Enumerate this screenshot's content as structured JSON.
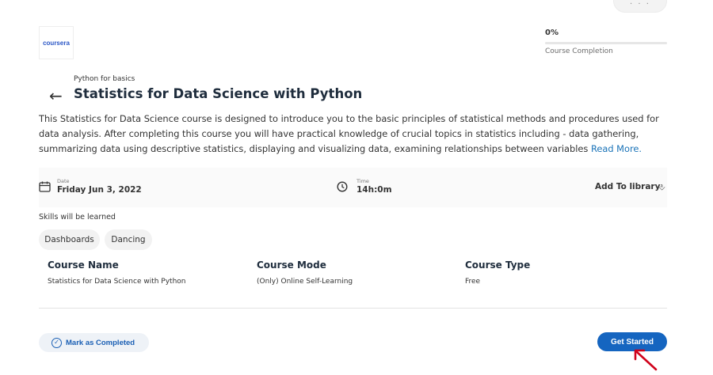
{
  "header": {
    "logo_text": "coursera",
    "top_pill_dots": "· · ·",
    "progress": {
      "percent_label": "0%",
      "fraction": 0,
      "label": "Course Completion"
    },
    "breadcrumb": "Python for basics",
    "title": "Statistics for Data Science with Python"
  },
  "description": {
    "text": "This Statistics for Data Science course is designed to introduce you to the basic principles of statistical methods and procedures used for data analysis. After completing this course you will have practical knowledge of crucial topics in statistics including - data gathering, summarizing data using descriptive statistics, displaying and visualizing data, examining relationships between variables ",
    "read_more": "Read More."
  },
  "info": {
    "date_label": "Date",
    "date_value": "Friday Jun 3, 2022",
    "time_label": "Time",
    "time_value": "14h:0m",
    "add_library": "Add To library"
  },
  "skills": {
    "title": "Skills will be learned",
    "items": [
      "Dashboards",
      "Dancing"
    ]
  },
  "details": {
    "course_name_head": "Course Name",
    "course_name": "Statistics for Data Science with Python",
    "course_mode_head": "Course Mode",
    "course_mode": "(Only) Online Self-Learning",
    "course_type_head": "Course Type",
    "course_type": "Free"
  },
  "footer": {
    "mark_completed": "Mark as Completed",
    "get_started": "Get Started"
  },
  "colors": {
    "accent": "#1565c0",
    "link": "#1a73b8",
    "title": "#1f2d3d",
    "cursor": "#d0021b"
  },
  "icons": {
    "back": "arrow-left-icon",
    "date": "calendar-icon",
    "time": "clock-icon",
    "library": "graduation-cap-icon",
    "check": "check-circle-icon",
    "pointer": "cursor-arrow-icon"
  }
}
